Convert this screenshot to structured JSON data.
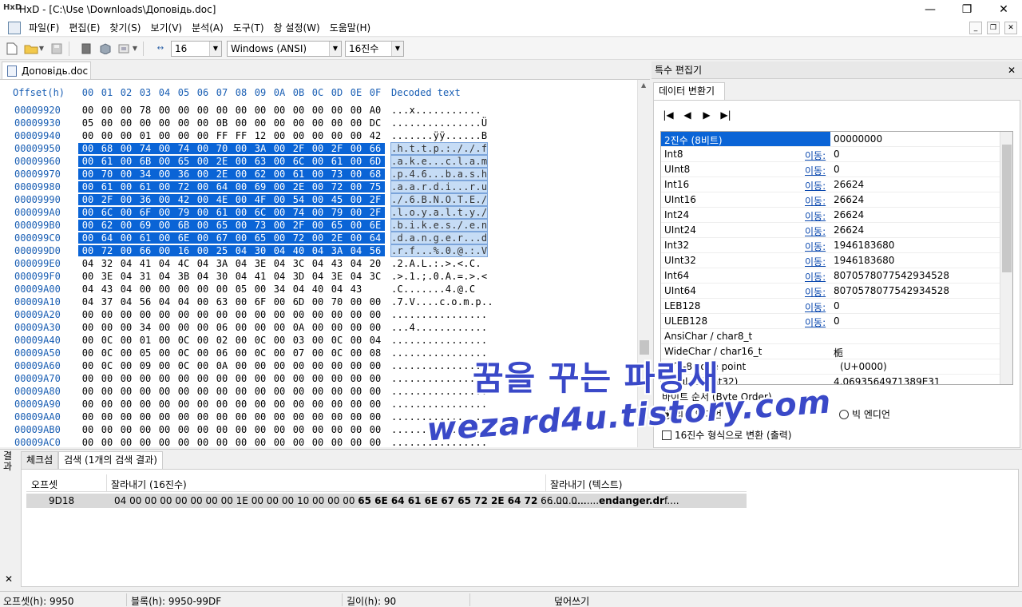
{
  "window": {
    "title": "HxD - [C:\\Use       \\Downloads\\Доповідь.doc]",
    "app_icon": "HxD",
    "minimize": "—",
    "restore": "❐",
    "close": "✕"
  },
  "menu": {
    "items": [
      "파일(F)",
      "편집(E)",
      "찾기(S)",
      "보기(V)",
      "분석(A)",
      "도구(T)",
      "창 설정(W)",
      "도움말(H)"
    ],
    "mdi_buttons": [
      "_",
      "❐",
      "✕"
    ]
  },
  "toolbar": {
    "bytes_per_row": "16",
    "charset": "Windows (ANSI)",
    "offset_base": "16진수"
  },
  "document_tab": {
    "label": "Доповідь.doc"
  },
  "hex_editor": {
    "header": "Offset(h)  00 01 02 03 04 05 06 07 08 09 0A 0B 0C 0D 0E 0F  Decoded text",
    "rows": [
      {
        "offset": "00009920",
        "bytes": [
          "00",
          "00",
          "00",
          "78",
          "00",
          "00",
          "00",
          "00",
          "00",
          "00",
          "00",
          "00",
          "00",
          "00",
          "00",
          "A0"
        ],
        "text": "...x...........",
        "sel": false
      },
      {
        "offset": "00009930",
        "bytes": [
          "05",
          "00",
          "00",
          "00",
          "00",
          "00",
          "00",
          "0B",
          "00",
          "00",
          "00",
          "00",
          "00",
          "00",
          "00",
          "DC"
        ],
        "text": "...............Ü",
        "sel": false
      },
      {
        "offset": "00009940",
        "bytes": [
          "00",
          "00",
          "00",
          "01",
          "00",
          "00",
          "00",
          "FF",
          "FF",
          "12",
          "00",
          "00",
          "00",
          "00",
          "00",
          "42"
        ],
        "text": ".......ÿÿ......B",
        "sel": false
      },
      {
        "offset": "00009950",
        "bytes": [
          "00",
          "68",
          "00",
          "74",
          "00",
          "74",
          "00",
          "70",
          "00",
          "3A",
          "00",
          "2F",
          "00",
          "2F",
          "00",
          "66"
        ],
        "text": ".h.t.t.p.:././.f",
        "sel": true
      },
      {
        "offset": "00009960",
        "bytes": [
          "00",
          "61",
          "00",
          "6B",
          "00",
          "65",
          "00",
          "2E",
          "00",
          "63",
          "00",
          "6C",
          "00",
          "61",
          "00",
          "6D"
        ],
        "text": ".a.k.e...c.l.a.m",
        "sel": true
      },
      {
        "offset": "00009970",
        "bytes": [
          "00",
          "70",
          "00",
          "34",
          "00",
          "36",
          "00",
          "2E",
          "00",
          "62",
          "00",
          "61",
          "00",
          "73",
          "00",
          "68"
        ],
        "text": ".p.4.6...b.a.s.h",
        "sel": true
      },
      {
        "offset": "00009980",
        "bytes": [
          "00",
          "61",
          "00",
          "61",
          "00",
          "72",
          "00",
          "64",
          "00",
          "69",
          "00",
          "2E",
          "00",
          "72",
          "00",
          "75"
        ],
        "text": ".a.a.r.d.i...r.u",
        "sel": true
      },
      {
        "offset": "00009990",
        "bytes": [
          "00",
          "2F",
          "00",
          "36",
          "00",
          "42",
          "00",
          "4E",
          "00",
          "4F",
          "00",
          "54",
          "00",
          "45",
          "00",
          "2F"
        ],
        "text": "./.6.B.N.O.T.E./",
        "sel": true
      },
      {
        "offset": "000099A0",
        "bytes": [
          "00",
          "6C",
          "00",
          "6F",
          "00",
          "79",
          "00",
          "61",
          "00",
          "6C",
          "00",
          "74",
          "00",
          "79",
          "00",
          "2F"
        ],
        "text": ".l.o.y.a.l.t.y./",
        "sel": true
      },
      {
        "offset": "000099B0",
        "bytes": [
          "00",
          "62",
          "00",
          "69",
          "00",
          "6B",
          "00",
          "65",
          "00",
          "73",
          "00",
          "2F",
          "00",
          "65",
          "00",
          "6E"
        ],
        "text": ".b.i.k.e.s./.e.n",
        "sel": true
      },
      {
        "offset": "000099C0",
        "bytes": [
          "00",
          "64",
          "00",
          "61",
          "00",
          "6E",
          "00",
          "67",
          "00",
          "65",
          "00",
          "72",
          "00",
          "2E",
          "00",
          "64"
        ],
        "text": ".d.a.n.g.e.r...d",
        "sel": true
      },
      {
        "offset": "000099D0",
        "bytes": [
          "00",
          "72",
          "00",
          "66",
          "00",
          "16",
          "00",
          "25",
          "04",
          "30",
          "04",
          "40",
          "04",
          "3A",
          "04",
          "56"
        ],
        "text": ".r.f...%.0.@.:.V",
        "sel": true,
        "sel_partial": 15
      },
      {
        "offset": "000099E0",
        "bytes": [
          "04",
          "32",
          "04",
          "41",
          "04",
          "4C",
          "04",
          "3A",
          "04",
          "3E",
          "04",
          "3C",
          "04",
          "43",
          "04",
          "20"
        ],
        "text": ".2.A.L.:.>.<.C. ",
        "sel": false
      },
      {
        "offset": "000099F0",
        "bytes": [
          "00",
          "3E",
          "04",
          "31",
          "04",
          "3B",
          "04",
          "30",
          "04",
          "41",
          "04",
          "3D",
          "04",
          "3E",
          "04",
          "3C"
        ],
        "text": ".>.1.;.0.A.=.>.<",
        "sel": false
      },
      {
        "offset": "00009A00",
        "bytes": [
          "04",
          "43",
          "04",
          "00",
          "00",
          "00",
          "00",
          "00",
          "05",
          "00",
          "34",
          "04",
          "40",
          "04",
          "43"
        ],
        "text": ".C.......4.@.C",
        "sel": false
      },
      {
        "offset": "00009A10",
        "bytes": [
          "04",
          "37",
          "04",
          "56",
          "04",
          "04",
          "00",
          "63",
          "00",
          "6F",
          "00",
          "6D",
          "00",
          "70",
          "00",
          "00"
        ],
        "text": ".7.V....c.o.m.p..",
        "sel": false
      },
      {
        "offset": "00009A20",
        "bytes": [
          "00",
          "00",
          "00",
          "00",
          "00",
          "00",
          "00",
          "00",
          "00",
          "00",
          "00",
          "00",
          "00",
          "00",
          "00",
          "00"
        ],
        "text": "................",
        "sel": false
      },
      {
        "offset": "00009A30",
        "bytes": [
          "00",
          "00",
          "00",
          "34",
          "00",
          "00",
          "00",
          "06",
          "00",
          "00",
          "00",
          "0A",
          "00",
          "00",
          "00",
          "00"
        ],
        "text": "...4............",
        "sel": false
      },
      {
        "offset": "00009A40",
        "bytes": [
          "00",
          "0C",
          "00",
          "01",
          "00",
          "0C",
          "00",
          "02",
          "00",
          "0C",
          "00",
          "03",
          "00",
          "0C",
          "00",
          "04"
        ],
        "text": "................",
        "sel": false
      },
      {
        "offset": "00009A50",
        "bytes": [
          "00",
          "0C",
          "00",
          "05",
          "00",
          "0C",
          "00",
          "06",
          "00",
          "0C",
          "00",
          "07",
          "00",
          "0C",
          "00",
          "08"
        ],
        "text": "................",
        "sel": false
      },
      {
        "offset": "00009A60",
        "bytes": [
          "00",
          "0C",
          "00",
          "09",
          "00",
          "0C",
          "00",
          "0A",
          "00",
          "00",
          "00",
          "00",
          "00",
          "00",
          "00",
          "00"
        ],
        "text": "................",
        "sel": false
      },
      {
        "offset": "00009A70",
        "bytes": [
          "00",
          "00",
          "00",
          "00",
          "00",
          "00",
          "00",
          "00",
          "00",
          "00",
          "00",
          "00",
          "00",
          "00",
          "00",
          "00"
        ],
        "text": "................",
        "sel": false
      },
      {
        "offset": "00009A80",
        "bytes": [
          "00",
          "00",
          "00",
          "00",
          "00",
          "00",
          "00",
          "00",
          "00",
          "00",
          "00",
          "00",
          "00",
          "00",
          "00",
          "00"
        ],
        "text": "................",
        "sel": false
      },
      {
        "offset": "00009A90",
        "bytes": [
          "00",
          "00",
          "00",
          "00",
          "00",
          "00",
          "00",
          "00",
          "00",
          "00",
          "00",
          "00",
          "00",
          "00",
          "00",
          "00"
        ],
        "text": "................",
        "sel": false
      },
      {
        "offset": "00009AA0",
        "bytes": [
          "00",
          "00",
          "00",
          "00",
          "00",
          "00",
          "00",
          "00",
          "00",
          "00",
          "00",
          "00",
          "00",
          "00",
          "00",
          "00"
        ],
        "text": "................",
        "sel": false
      },
      {
        "offset": "00009AB0",
        "bytes": [
          "00",
          "00",
          "00",
          "00",
          "00",
          "00",
          "00",
          "00",
          "00",
          "00",
          "00",
          "00",
          "00",
          "00",
          "00",
          "00"
        ],
        "text": "................",
        "sel": false
      },
      {
        "offset": "00009AC0",
        "bytes": [
          "00",
          "00",
          "00",
          "00",
          "00",
          "00",
          "00",
          "00",
          "00",
          "00",
          "00",
          "00",
          "00",
          "00",
          "00",
          "00"
        ],
        "text": "................",
        "sel": false
      }
    ]
  },
  "special_editor": {
    "panel_title": "특수 편집기",
    "tab": "데이터 변환기",
    "nav_buttons": [
      "|◀",
      "◀",
      "▶",
      "▶|"
    ],
    "goto_label": "이동:",
    "rows": [
      {
        "name": "2진수 (8비트)",
        "goto": false,
        "value": "00000000",
        "selected": true
      },
      {
        "name": "Int8",
        "goto": true,
        "value": "0"
      },
      {
        "name": "UInt8",
        "goto": true,
        "value": "0"
      },
      {
        "name": "Int16",
        "goto": true,
        "value": "26624"
      },
      {
        "name": "UInt16",
        "goto": true,
        "value": "26624"
      },
      {
        "name": "Int24",
        "goto": true,
        "value": "26624"
      },
      {
        "name": "UInt24",
        "goto": true,
        "value": "26624"
      },
      {
        "name": "Int32",
        "goto": true,
        "value": "1946183680"
      },
      {
        "name": "UInt32",
        "goto": true,
        "value": "1946183680"
      },
      {
        "name": "Int64",
        "goto": true,
        "value": "8070578077542934528"
      },
      {
        "name": "UInt64",
        "goto": true,
        "value": "8070578077542934528"
      },
      {
        "name": "LEB128",
        "goto": true,
        "value": "0"
      },
      {
        "name": "ULEB128",
        "goto": true,
        "value": "0"
      },
      {
        "name": "AnsiChar / char8_t",
        "goto": false,
        "value": ""
      },
      {
        "name": "WideChar / char16_t",
        "goto": false,
        "value": "栀"
      },
      {
        "name": "UTF-8 code point",
        "goto": false,
        "value": "(U+0000)"
      },
      {
        "name": "Single (float32)",
        "goto": false,
        "value": "4.0693564971389E31"
      }
    ],
    "byte_order_label": "바이트 순서 (Byte Order)",
    "little_endian": "리틀 엔디언",
    "big_endian": "빅 엔디언",
    "hex_checkbox": "16진수 형식으로 변환 (출력)"
  },
  "watermark": {
    "line1": "꿈을 꾸는 파랑새",
    "line2": "wezard4u.tistory.com"
  },
  "results": {
    "side_label": "결과",
    "close": "✕",
    "tabs": [
      "체크섬",
      "검색 (1개의 검색 결과)"
    ],
    "columns": [
      "오프셋",
      "잘라내기 (16진수)",
      "잘라내기 (텍스트)"
    ],
    "row": {
      "offset": "9D18",
      "hex_plain": "04 00 00 00 00 00 00 00 1E 00 00 00 10 00 00 00 ",
      "hex_bold": "65 6E 64 61 6E 67 65 72 2E 64 72",
      "hex_tail": " 66 00 0...",
      "text_plain": "................",
      "text_bold": "endanger.dr",
      "text_tail": "f...."
    }
  },
  "statusbar": {
    "offset": "오프셋(h): 9950",
    "block": "블록(h): 9950-99DF",
    "length": "길이(h): 90",
    "mode": "덮어쓰기"
  },
  "colors": {
    "selection": "#0a64d6",
    "offset_blue": "#1a5fb4",
    "watermark": "#3a49c8"
  }
}
